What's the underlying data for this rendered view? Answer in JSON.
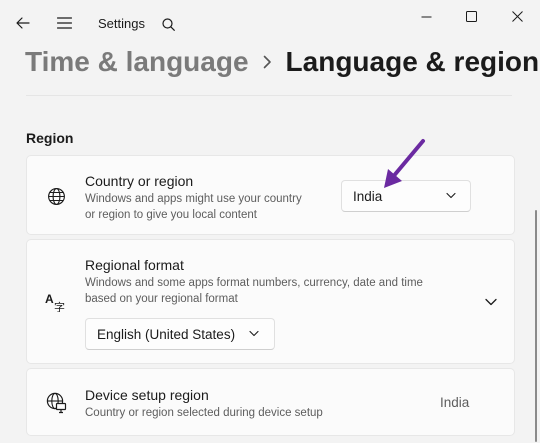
{
  "window": {
    "app_title": "Settings"
  },
  "breadcrumb": {
    "parent": "Time & language",
    "current": "Language & region"
  },
  "section": {
    "title": "Region"
  },
  "country": {
    "title": "Country or region",
    "desc_line1": "Windows and apps might use your country",
    "desc_line2": "or region to give you local content",
    "value": "India",
    "icon": "globe-icon"
  },
  "regional_format": {
    "title": "Regional format",
    "desc_line1": "Windows and some apps format numbers, currency, date and time",
    "desc_line2": "based on your regional format",
    "value": "English (United States)",
    "icon": "language-icon"
  },
  "device_region": {
    "title": "Device setup region",
    "desc": "Country or region selected during device setup",
    "value": "India",
    "icon": "globe-monitor-icon"
  },
  "colors": {
    "annotation_arrow": "#6b2aa1"
  }
}
